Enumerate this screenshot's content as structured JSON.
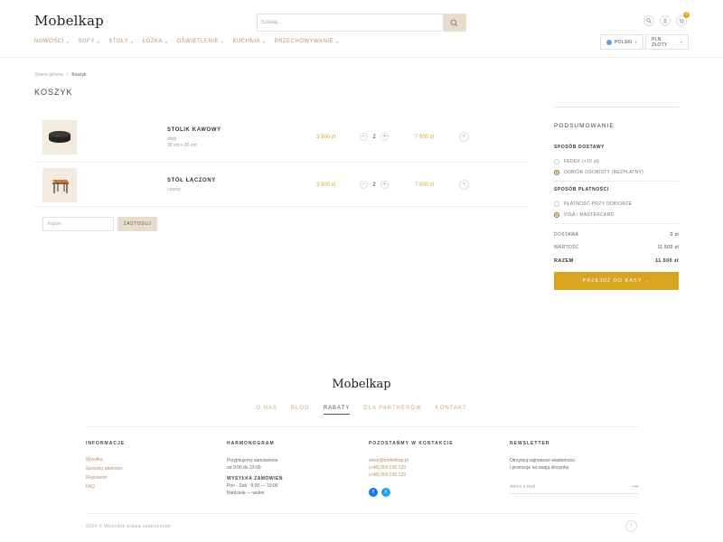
{
  "header": {
    "logo": "Mobelkap",
    "search_placeholder": "Szukaj...",
    "cart_count": "0",
    "nav": [
      {
        "label": "NOWOŚCI"
      },
      {
        "label": "SOFY"
      },
      {
        "label": "STOŁY"
      },
      {
        "label": "ŁÓŻKA"
      },
      {
        "label": "OŚWIETLENIE"
      },
      {
        "label": "KUCHNIA"
      },
      {
        "label": "PRZECHOWYWANIE"
      }
    ],
    "language": "POLSKI",
    "currency": "PLN ZŁOTY"
  },
  "breadcrumb": {
    "home": "Strona główna",
    "separator": "/",
    "current": "Koszyk"
  },
  "page_title": "KOSZYK",
  "cart": {
    "items": [
      {
        "name": "STOLIK KAWOWY",
        "meta1": "złoty",
        "meta2": "30 cm x 30 cm",
        "price": "3 500 zł",
        "qty": "2",
        "total": "7 000 zł"
      },
      {
        "name": "STÓŁ ŁĄCZONY",
        "meta1": "czarny",
        "meta2": "",
        "price": "3 500 zł",
        "qty": "2",
        "total": "7 000 zł"
      }
    ],
    "coupon_placeholder": "Kupon",
    "apply_label": "ZASTOSUJ"
  },
  "summary": {
    "title": "PODSUMOWANIE",
    "delivery_title": "SPOSÓB DOSTAWY",
    "delivery_options": [
      {
        "label": "FEDEX (+15 zł)",
        "selected": false
      },
      {
        "label": "ODBIÓR OSOBISTY (BEZPŁATNY)",
        "selected": true
      }
    ],
    "payment_title": "SPOSÓB PŁATNOŚCI",
    "payment_options": [
      {
        "label": "PŁATNOŚĆ PRZY ODBIORZE",
        "selected": false
      },
      {
        "label": "VISA / MASTERCARD",
        "selected": true
      }
    ],
    "shipping_label": "DOSTAWA",
    "shipping_value": "0 zł",
    "subtotal_label": "WARTOŚĆ",
    "subtotal_value": "11 500 zł",
    "total_label": "RAZEM",
    "total_value": "11 500 zł",
    "checkout_label": "PRZEJDŹ DO KASY →"
  },
  "footer": {
    "logo": "Mobelkap",
    "nav": [
      "O NAS",
      "BLOG",
      "RABATY",
      "DLA PARTNERÓW",
      "KONTAKT"
    ],
    "info_title": "INFORMACJE",
    "info_links": [
      "Wysyłka",
      "Sposoby płatności",
      "Regulamin",
      "FAQ"
    ],
    "schedule_title": "HARMONOGRAM",
    "schedule_line1": "Przyjmujemy zamówienia",
    "schedule_line2": "od 9:00 do 23:00",
    "shipping_title": "WYSYŁKA ZAMÓWIEŃ",
    "shipping_line1": "Pon - Sob : 9:00 — 19:00",
    "shipping_line2": "Niedziela — wolne",
    "contact_title": "POZOSTAŃMY W KONTAKCIE",
    "contact_email": "sklep@mobelkap.pl",
    "contact_phone1": "(+48) 000 010 120",
    "contact_phone2": "(+48) 000 010 120",
    "newsletter_title": "NEWSLETTER",
    "newsletter_line1": "Otrzymuj najnowsze wiadomości",
    "newsletter_line2": "i promocje na swoją skrzynkę.",
    "newsletter_placeholder": "Adres e-mail",
    "copyright": "2024 © Wszelkie prawa zastrzeżone"
  },
  "colors": {
    "accent": "#d9a520",
    "beige": "#e8dccd",
    "nav_text": "#b8916a",
    "facebook": "#1877f2",
    "twitter": "#1da1f2"
  }
}
